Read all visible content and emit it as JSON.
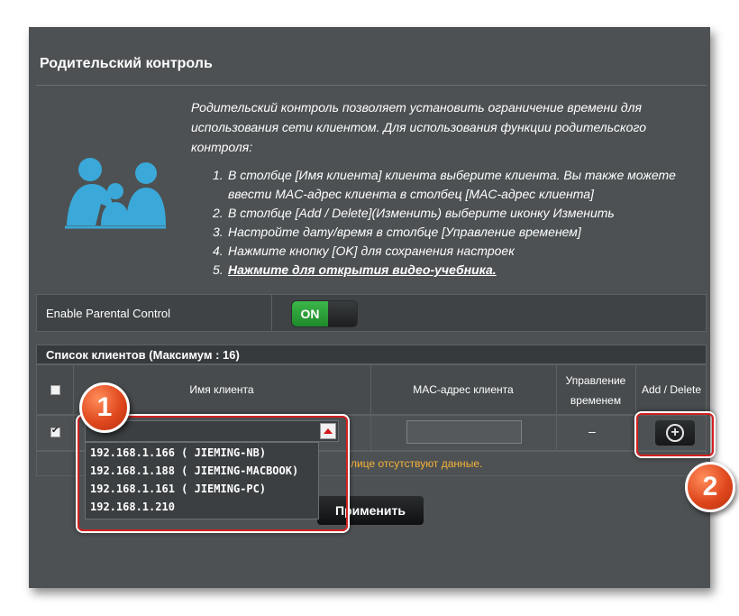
{
  "panel": {
    "title": "Родительский контроль",
    "description": "Родительский контроль позволяет установить ограничение времени для использования сети клиентом. Для использования функции родительского контроля:",
    "steps": [
      {
        "num": "1.",
        "line1": "В столбце [Имя клиента] клиента выберите клиента. Вы также можете",
        "line2": "ввести MAC-адрес клиента в столбец [MAC-адрес клиента]"
      },
      {
        "num": "2.",
        "line1": "В столбце [Add / Delete](Изменить) выберите иконку Изменить",
        "line2": ""
      },
      {
        "num": "3.",
        "line1": "Настройте дату/время в столбце [Управление временем]",
        "line2": ""
      },
      {
        "num": "4.",
        "line1": "Нажмите кнопку [OK] для сохранения настроек",
        "line2": ""
      },
      {
        "num": "5.",
        "line1": "Нажмите для открытия видео-учебника.",
        "line2": ""
      }
    ],
    "icon": "family-icon"
  },
  "enable": {
    "label": "Enable Parental Control",
    "toggle_label": "ON",
    "state": "on"
  },
  "client_list": {
    "title": "Список клиентов (Максимум : 16)",
    "columns": {
      "name": "Имя клиента",
      "mac": "MAC-адрес клиента",
      "time_line1": "Управление",
      "time_line2": "временем",
      "add_delete": "Add / Delete"
    },
    "row": {
      "checked": true,
      "time_value": "–",
      "add_icon": "plus-circle-icon"
    },
    "empty_message": "лице отсутствуют данные.",
    "dropdown_options": [
      "192.168.1.166 ( JIEMING-NB)",
      "192.168.1.188 ( JIEMING-MACBOOK)",
      "192.168.1.161 ( JIEMING-PC)",
      "192.168.1.210"
    ]
  },
  "apply_button": "Применить",
  "badges": [
    "1",
    "2"
  ],
  "colors": {
    "panel_bg": "#4d5153",
    "toggle_on": "#2e9e3b",
    "highlight": "#d32020",
    "badge": "#e0481e",
    "warning_text": "#f5b33a",
    "icon_blue": "#3aa8d8"
  }
}
